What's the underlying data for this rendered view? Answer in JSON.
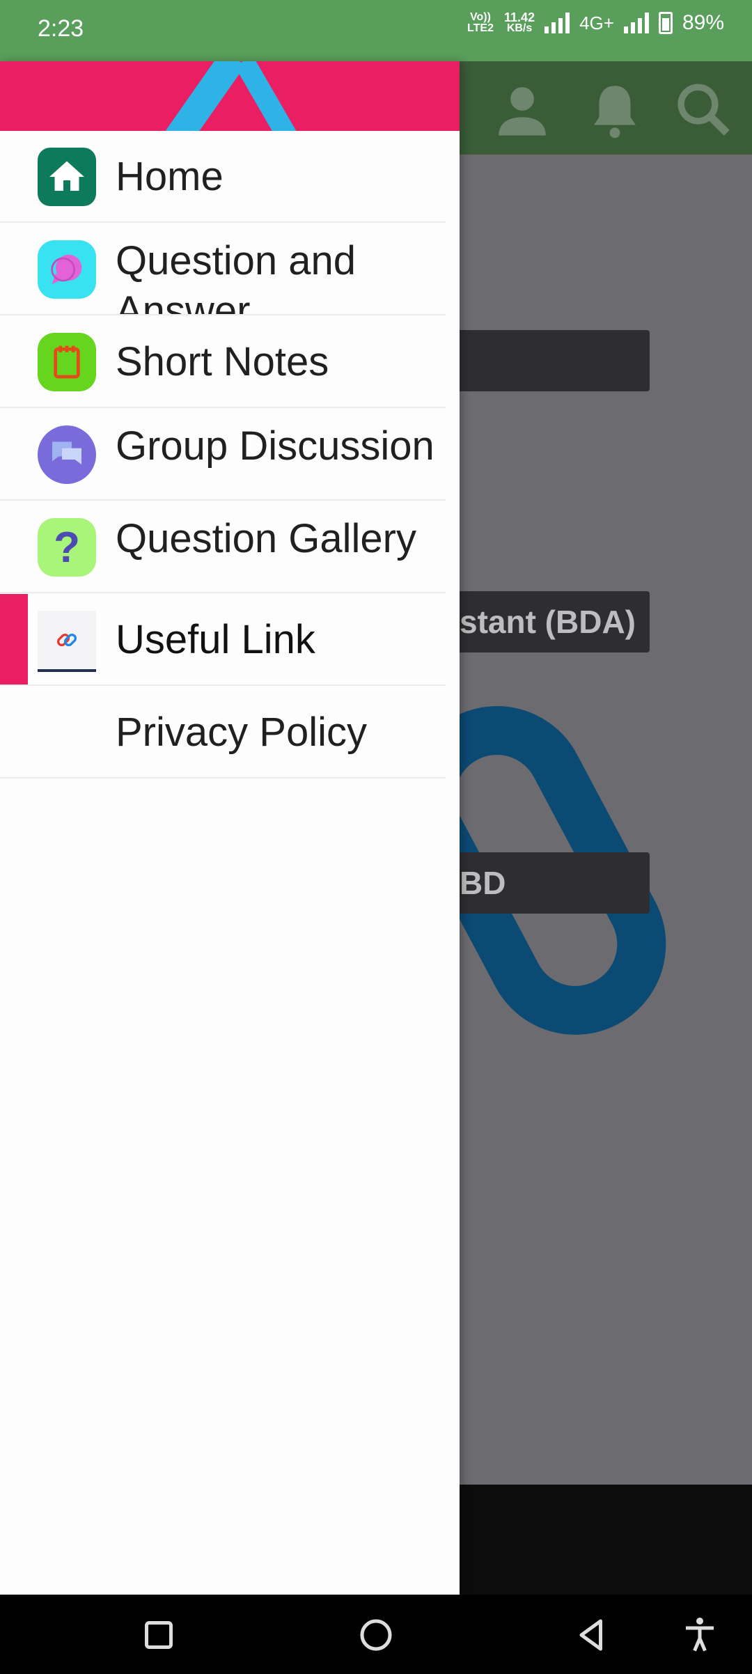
{
  "status_bar": {
    "time": "2:23",
    "volte": "Vo)) LTE2",
    "speed_value": "11.42",
    "speed_unit": "KB/s",
    "network": "4G+",
    "battery": "89%"
  },
  "background": {
    "bar1": "",
    "bar2": "stant (BDA)",
    "bar3": "BD"
  },
  "drawer": {
    "items": [
      {
        "label": "Home",
        "icon": "home-icon"
      },
      {
        "label": "Question and Answer",
        "icon": "chat-bubble-icon"
      },
      {
        "label": "Short Notes",
        "icon": "notepad-icon"
      },
      {
        "label": "Group Discussion",
        "icon": "forum-icon"
      },
      {
        "label": "Question Gallery",
        "icon": "question-mark-icon"
      },
      {
        "label": "Useful Link",
        "icon": "link-icon"
      },
      {
        "label": "Privacy Policy",
        "icon": ""
      }
    ]
  },
  "colors": {
    "accent": "#ea1e63",
    "status_bar": "#5a9e5b"
  }
}
